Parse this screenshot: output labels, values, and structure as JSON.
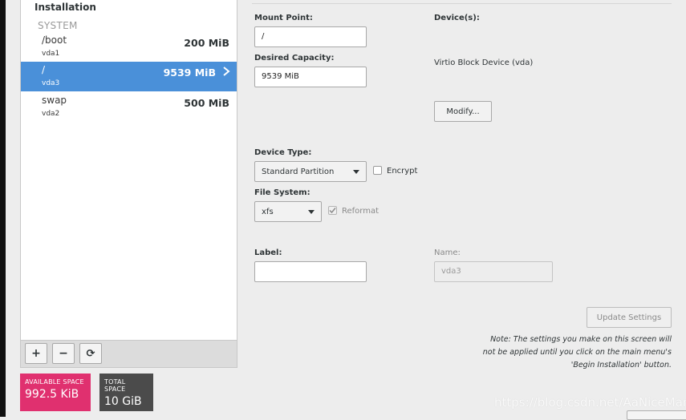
{
  "left_panel": {
    "title": "Installation",
    "group": "SYSTEM",
    "partitions": [
      {
        "mount": "/boot",
        "device": "vda1",
        "size": "200 MiB"
      },
      {
        "mount": "/",
        "device": "vda3",
        "size": "9539 MiB",
        "selected": true
      },
      {
        "mount": "swap",
        "device": "vda2",
        "size": "500 MiB"
      }
    ],
    "toolbar": {
      "add": "+",
      "remove": "−",
      "refresh": "⟳"
    }
  },
  "space": {
    "available_label": "AVAILABLE SPACE",
    "available_value": "992.5 KiB",
    "total_label": "TOTAL SPACE",
    "total_value": "10 GiB"
  },
  "details": {
    "mount_point_label": "Mount Point:",
    "mount_point_value": "/",
    "desired_capacity_label": "Desired Capacity:",
    "desired_capacity_value": "9539 MiB",
    "devices_label": "Device(s):",
    "device_name": "Virtio Block Device (vda)",
    "modify_button": "Modify...",
    "device_type_label": "Device Type:",
    "device_type_value": "Standard Partition",
    "encrypt_label": "Encrypt",
    "file_system_label": "File System:",
    "file_system_value": "xfs",
    "reformat_label": "Reformat",
    "label_label": "Label:",
    "label_value": "",
    "name_label": "Name:",
    "name_value": "vda3",
    "update_button": "Update Settings",
    "note_line1": "Note:  The settings you make on this screen will",
    "note_line2": "not be applied until you click on the main menu's",
    "note_line3": "'Begin Installation' button."
  },
  "watermark": "https://blog.csdn.net/AaNiceMan",
  "colors": {
    "selected_row": "#4a90d9",
    "available_space": "#e0306f",
    "total_space": "#4b4b4b"
  }
}
